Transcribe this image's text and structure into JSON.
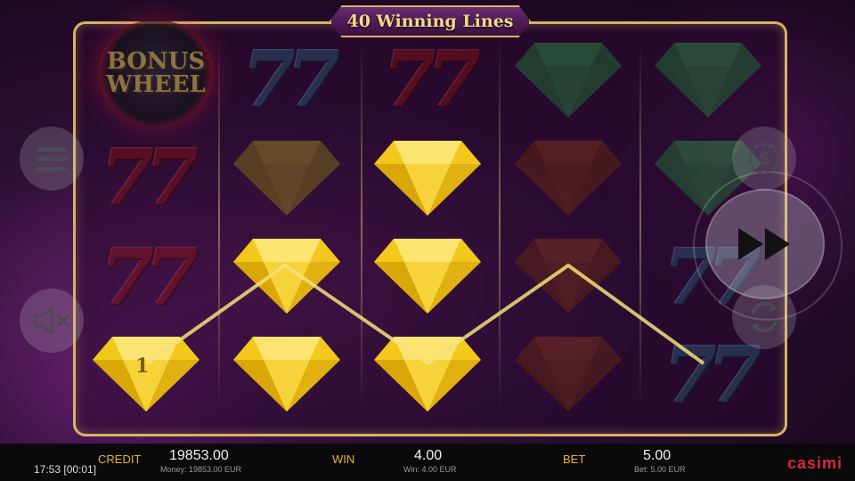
{
  "title": "40 Winning Lines",
  "bonus_symbol": {
    "line1": "BONUS",
    "line2": "WHEEL"
  },
  "win_line_number": "1",
  "colors": {
    "gold": "#d6b262",
    "yellow_gem": "#f2c81c",
    "green_gem": "#1f7a35",
    "brown_gem": "#6b2a0f",
    "red_seven": "#8c1414",
    "blue_seven": "#2a5d78"
  },
  "reels": [
    [
      "bonus-wheel",
      "seven-red",
      "seven-red",
      "gem-yellow"
    ],
    [
      "seven-blue",
      "gem-olive",
      "gem-yellow",
      "gem-yellow"
    ],
    [
      "seven-red",
      "gem-yellow",
      "gem-yellow",
      "gem-yellow"
    ],
    [
      "gem-green",
      "gem-brown",
      "gem-brown",
      "gem-brown"
    ],
    [
      "gem-green",
      "gem-green",
      "seven-blue",
      "seven-blue"
    ]
  ],
  "seven_text": "77",
  "controls": {
    "menu_icon": "hamburger-icon",
    "sound_icon": "speaker-muted-icon",
    "coin_icon": "dollar-coin-icon",
    "spin_icon": "fast-forward-icon",
    "autoplay_icon": "refresh-icon"
  },
  "bottom_bar": {
    "clock": "17:53 [00:01]",
    "credit_label": "CREDIT",
    "credit_value": "19853.00",
    "credit_sub": "Money: 19853.00 EUR",
    "win_label": "WIN",
    "win_value": "4.00",
    "win_sub": "Win: 4.00 EUR",
    "bet_label": "BET",
    "bet_value": "5.00",
    "bet_sub": "Bet: 5.00 EUR",
    "logo": "casimi"
  }
}
